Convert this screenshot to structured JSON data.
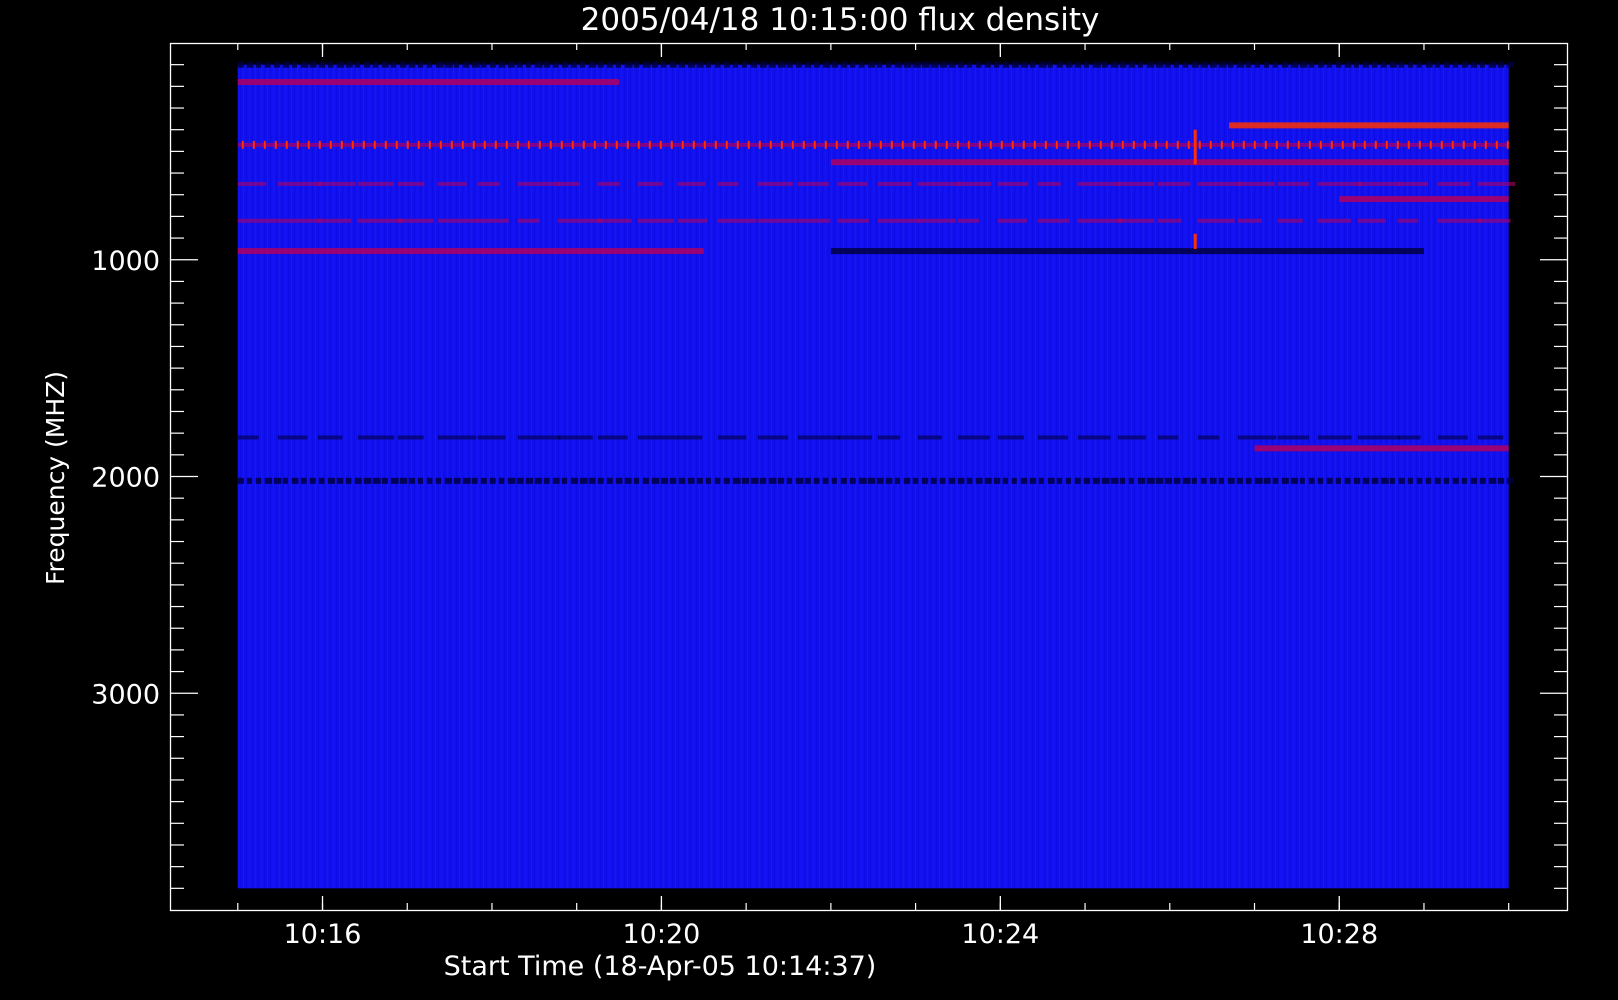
{
  "chart_data": {
    "type": "heatmap",
    "title": "2005/04/18 10:15:00 flux density",
    "xlabel": "Start Time (18-Apr-05 10:14:37)",
    "ylabel": "Frequency (MHZ)",
    "x_tick_labels": [
      "10:16",
      "10:20",
      "10:24",
      "10:28"
    ],
    "x_major_ticks_min": [
      16,
      20,
      24,
      28
    ],
    "x_minor_ticks_min": [
      15,
      16,
      17,
      18,
      19,
      20,
      21,
      22,
      23,
      24,
      25,
      26,
      27,
      28,
      29,
      30
    ],
    "xlim_min": [
      14.2,
      30.7
    ],
    "data_time_range_min": [
      15.0,
      30.0
    ],
    "y_tick_labels": [
      "1000",
      "2000",
      "3000"
    ],
    "y_major_ticks": [
      1000,
      2000,
      3000
    ],
    "y_minor_step": 100,
    "ylim": [
      4000,
      0
    ],
    "y_axis_inverted": true,
    "data_freq_range_mhz": [
      100,
      3900
    ],
    "colormap": {
      "background": "#1010f0",
      "low": "#000040",
      "mid": "#b00060",
      "high": "#ff3000"
    },
    "features": [
      {
        "kind": "band",
        "freq_mhz": 100,
        "t_start": 15.0,
        "t_end": 30.0,
        "intensity": "dark",
        "pattern": "dashed"
      },
      {
        "kind": "band",
        "freq_mhz": 180,
        "t_start": 15.0,
        "t_end": 19.5,
        "intensity": "mid"
      },
      {
        "kind": "band",
        "freq_mhz": 380,
        "t_start": 26.7,
        "t_end": 30.0,
        "intensity": "high"
      },
      {
        "kind": "band",
        "freq_mhz": 470,
        "t_start": 15.0,
        "t_end": 30.0,
        "intensity": "high",
        "pattern": "spikes"
      },
      {
        "kind": "band",
        "freq_mhz": 550,
        "t_start": 22.0,
        "t_end": 30.0,
        "intensity": "mid"
      },
      {
        "kind": "band",
        "freq_mhz": 650,
        "t_start": 15.0,
        "t_end": 30.0,
        "intensity": "mid",
        "pattern": "patchy"
      },
      {
        "kind": "band",
        "freq_mhz": 720,
        "t_start": 28.0,
        "t_end": 30.0,
        "intensity": "mid"
      },
      {
        "kind": "band",
        "freq_mhz": 820,
        "t_start": 15.0,
        "t_end": 30.0,
        "intensity": "mid",
        "pattern": "patchy"
      },
      {
        "kind": "band",
        "freq_mhz": 960,
        "t_start": 15.0,
        "t_end": 20.5,
        "intensity": "mid"
      },
      {
        "kind": "band",
        "freq_mhz": 960,
        "t_start": 22.0,
        "t_end": 29.0,
        "intensity": "dark"
      },
      {
        "kind": "band",
        "freq_mhz": 1820,
        "t_start": 15.0,
        "t_end": 30.0,
        "intensity": "dark",
        "pattern": "patchy"
      },
      {
        "kind": "band",
        "freq_mhz": 1870,
        "t_start": 27.0,
        "t_end": 30.0,
        "intensity": "mid"
      },
      {
        "kind": "band",
        "freq_mhz": 2020,
        "t_start": 15.0,
        "t_end": 30.0,
        "intensity": "dark",
        "pattern": "dashed"
      },
      {
        "kind": "burst",
        "time_min": 26.3,
        "freq_start": 400,
        "freq_end": 560
      },
      {
        "kind": "burst",
        "time_min": 26.3,
        "freq_start": 880,
        "freq_end": 950
      }
    ]
  }
}
